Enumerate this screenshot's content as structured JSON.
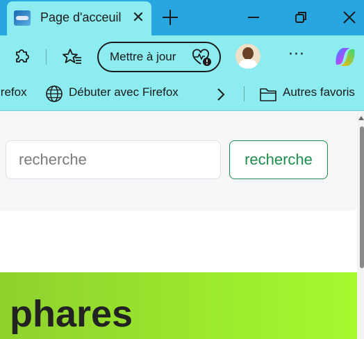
{
  "window": {
    "tab_title": "Page d'acceuil",
    "tab_close_symbol": "✕",
    "new_tab_icon": "plus-icon",
    "controls": [
      "minimize-icon",
      "restore-icon",
      "close-icon"
    ]
  },
  "toolbar": {
    "extensions_icon": "puzzle-icon",
    "favorites_icon": "star-list-icon",
    "update_label": "Mettre à jour",
    "update_icon": "heartbeat-alert-icon",
    "more_label": "···",
    "copilot_icon": "copilot-icon"
  },
  "bookmarks": {
    "items": [
      {
        "label": "irefox"
      },
      {
        "label": "Débuter avec Firefox",
        "icon": "globe-icon"
      }
    ],
    "overflow_icon": "chevron-right-icon",
    "other_favorites": {
      "label": "Autres favoris",
      "icon": "folder-icon"
    }
  },
  "page": {
    "search": {
      "placeholder": "recherche",
      "button_label": "recherche"
    },
    "banner_title": "phares"
  },
  "colors": {
    "tabstrip": "#27a6e0",
    "toolbar": "#8cecf0",
    "accent_green": "#1e8e4e",
    "banner_start": "#8ed12d",
    "banner_end": "#a6fa2f"
  }
}
